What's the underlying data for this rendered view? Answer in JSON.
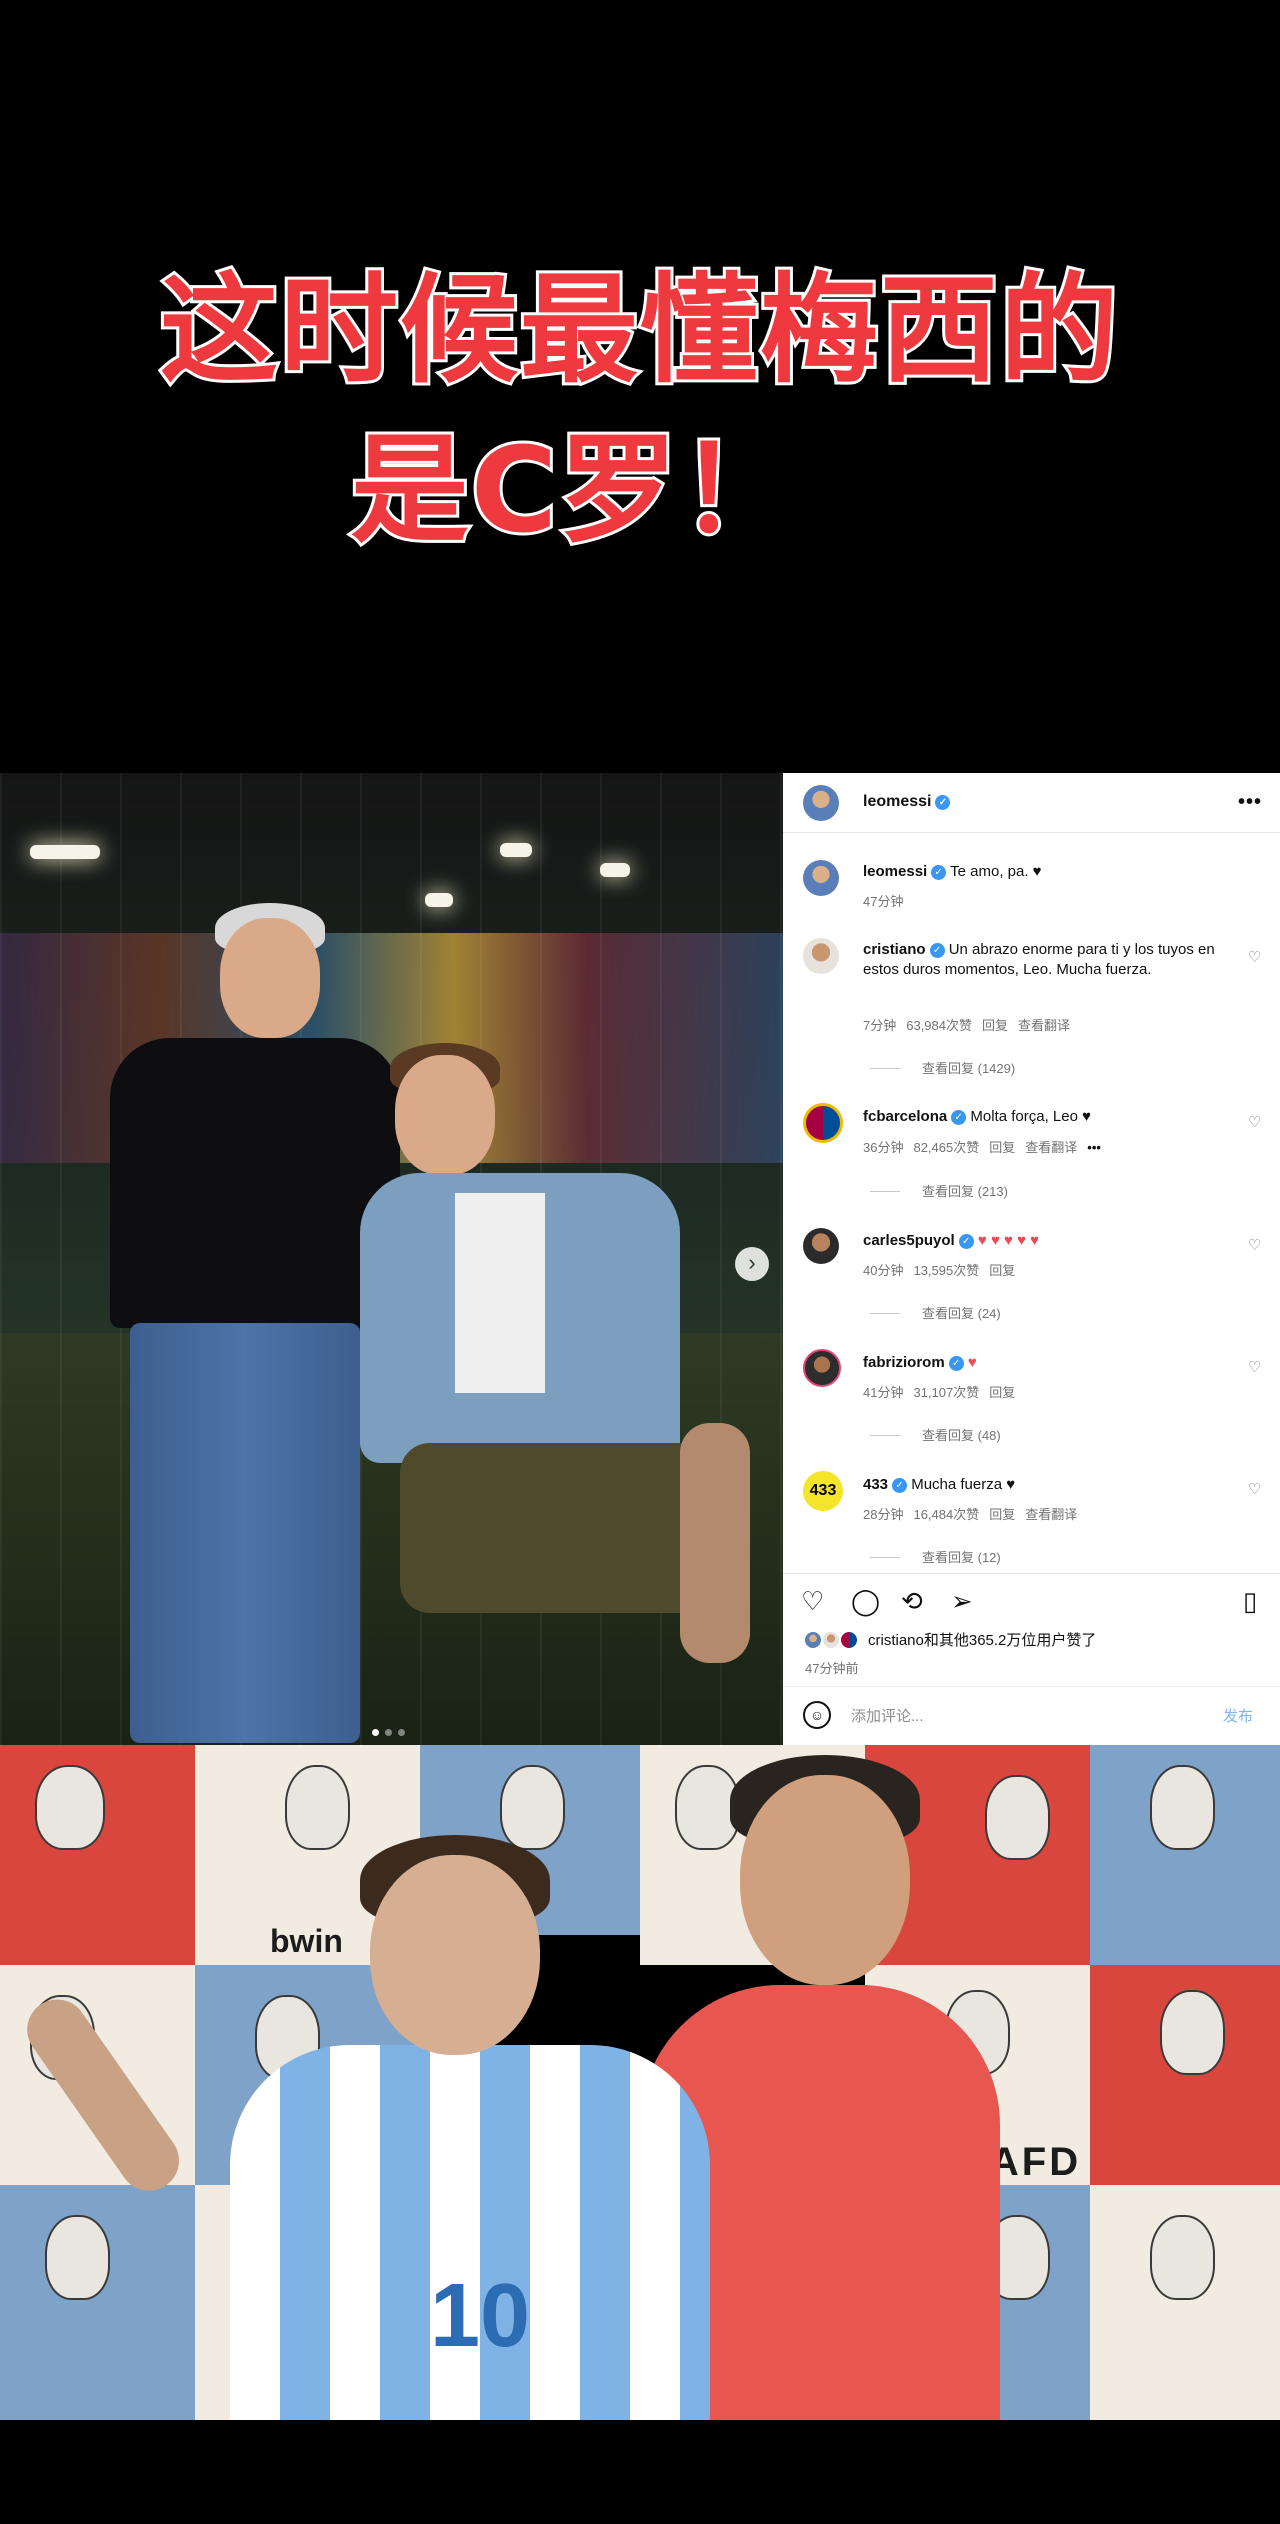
{
  "headline": {
    "line1": "这时候最懂梅西的",
    "line2": "是C罗！",
    "color": "#ee3a3f"
  },
  "photo": {
    "next_icon": "chevron-right-icon",
    "next_glyph": "›"
  },
  "instagram": {
    "header": {
      "username": "leomessi",
      "more": "•••"
    },
    "caption": {
      "username": "leomessi",
      "text": "Te amo, pa. ♥",
      "time": "47分钟"
    },
    "comments": [
      {
        "username": "cristiano",
        "text": "Un abrazo enorme para ti y los tuyos en estos duros momentos, Leo. Mucha fuerza.",
        "time": "7分钟",
        "likes": "63,984次赞",
        "reply": "回复",
        "translate": "查看翻译",
        "view_replies": "查看回复 (1429)"
      },
      {
        "username": "fcbarcelona",
        "text": "Molta força, Leo ♥",
        "time": "36分钟",
        "likes": "82,465次赞",
        "reply": "回复",
        "translate": "查看翻译",
        "extra": "•••",
        "view_replies": "查看回复 (213)"
      },
      {
        "username": "carles5puyol",
        "text": "♥ ♥ ♥ ♥ ♥",
        "time": "40分钟",
        "likes": "13,595次赞",
        "reply": "回复",
        "view_replies": "查看回复 (24)"
      },
      {
        "username": "fabriziorom",
        "text": "♥",
        "time": "41分钟",
        "likes": "31,107次赞",
        "reply": "回复",
        "view_replies": "查看回复 (48)"
      },
      {
        "username": "433",
        "avatar_text": "433",
        "text": "Mucha fuerza ♥",
        "time": "28分钟",
        "likes": "16,484次赞",
        "reply": "回复",
        "translate": "查看翻译",
        "view_replies": "查看回复 (12)"
      }
    ],
    "actions": {
      "liked_by": "cristiano和其他365.2万位用户赞了",
      "time": "47分钟前",
      "icons": [
        "heart-icon",
        "comment-icon",
        "repost-icon",
        "send-icon",
        "bookmark-icon"
      ]
    },
    "comment_bar": {
      "placeholder": "添加评论...",
      "post": "发布"
    }
  },
  "collage": {
    "shirt_number": "10",
    "kafd": "KAFD",
    "bwin": "bwin"
  }
}
